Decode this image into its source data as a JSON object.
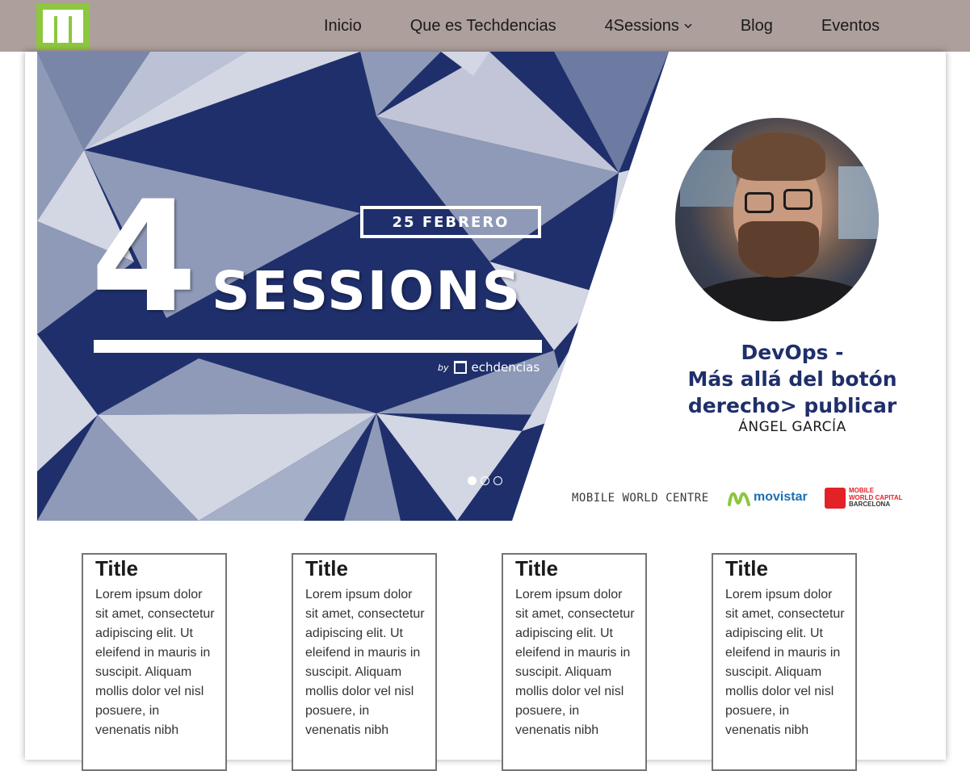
{
  "nav": {
    "items": [
      {
        "label": "Inicio"
      },
      {
        "label": "Que es Techdencias"
      },
      {
        "label": "4Sessions"
      },
      {
        "label": "Blog"
      },
      {
        "label": "Eventos"
      }
    ],
    "accent_color": "#8dc63f",
    "bar_color": "#ad9f9c"
  },
  "hero": {
    "date": "25 FEBRERO",
    "number": "4",
    "word": "SESSIONS",
    "by": "by",
    "brand": "echdencias",
    "talk_title_lines": [
      "DevOps -",
      "Más allá del botón",
      "derecho> publicar"
    ],
    "speaker": "ÁNGEL GARCÍA",
    "sponsors": {
      "mwc": "MOBILE WORLD CENTRE",
      "movistar": "movistar",
      "mwcb": [
        "MOBILE",
        "WORLD CAPITAL",
        "BARCELONA"
      ]
    },
    "carousel": {
      "count": 3,
      "active": 1
    },
    "colors": {
      "navy": "#1f2f6b",
      "mid": "#8f9ab8",
      "light": "#d3d6e3"
    }
  },
  "cards": [
    {
      "title": "Title",
      "body": "Lorem ipsum dolor sit amet, consectetur adipiscing elit. Ut eleifend in mauris in suscipit. Aliquam mollis dolor vel nisl posuere, in venenatis nibh"
    },
    {
      "title": "Title",
      "body": "Lorem ipsum dolor sit amet, consectetur adipiscing elit. Ut eleifend in mauris in suscipit. Aliquam mollis dolor vel nisl posuere, in venenatis nibh"
    },
    {
      "title": "Title",
      "body": "Lorem ipsum dolor sit amet, consectetur adipiscing elit. Ut eleifend in mauris in suscipit. Aliquam mollis dolor vel nisl posuere, in venenatis nibh"
    },
    {
      "title": "Title",
      "body": "Lorem ipsum dolor sit amet, consectetur adipiscing elit. Ut eleifend in mauris in suscipit. Aliquam mollis dolor vel nisl posuere, in venenatis nibh"
    }
  ]
}
